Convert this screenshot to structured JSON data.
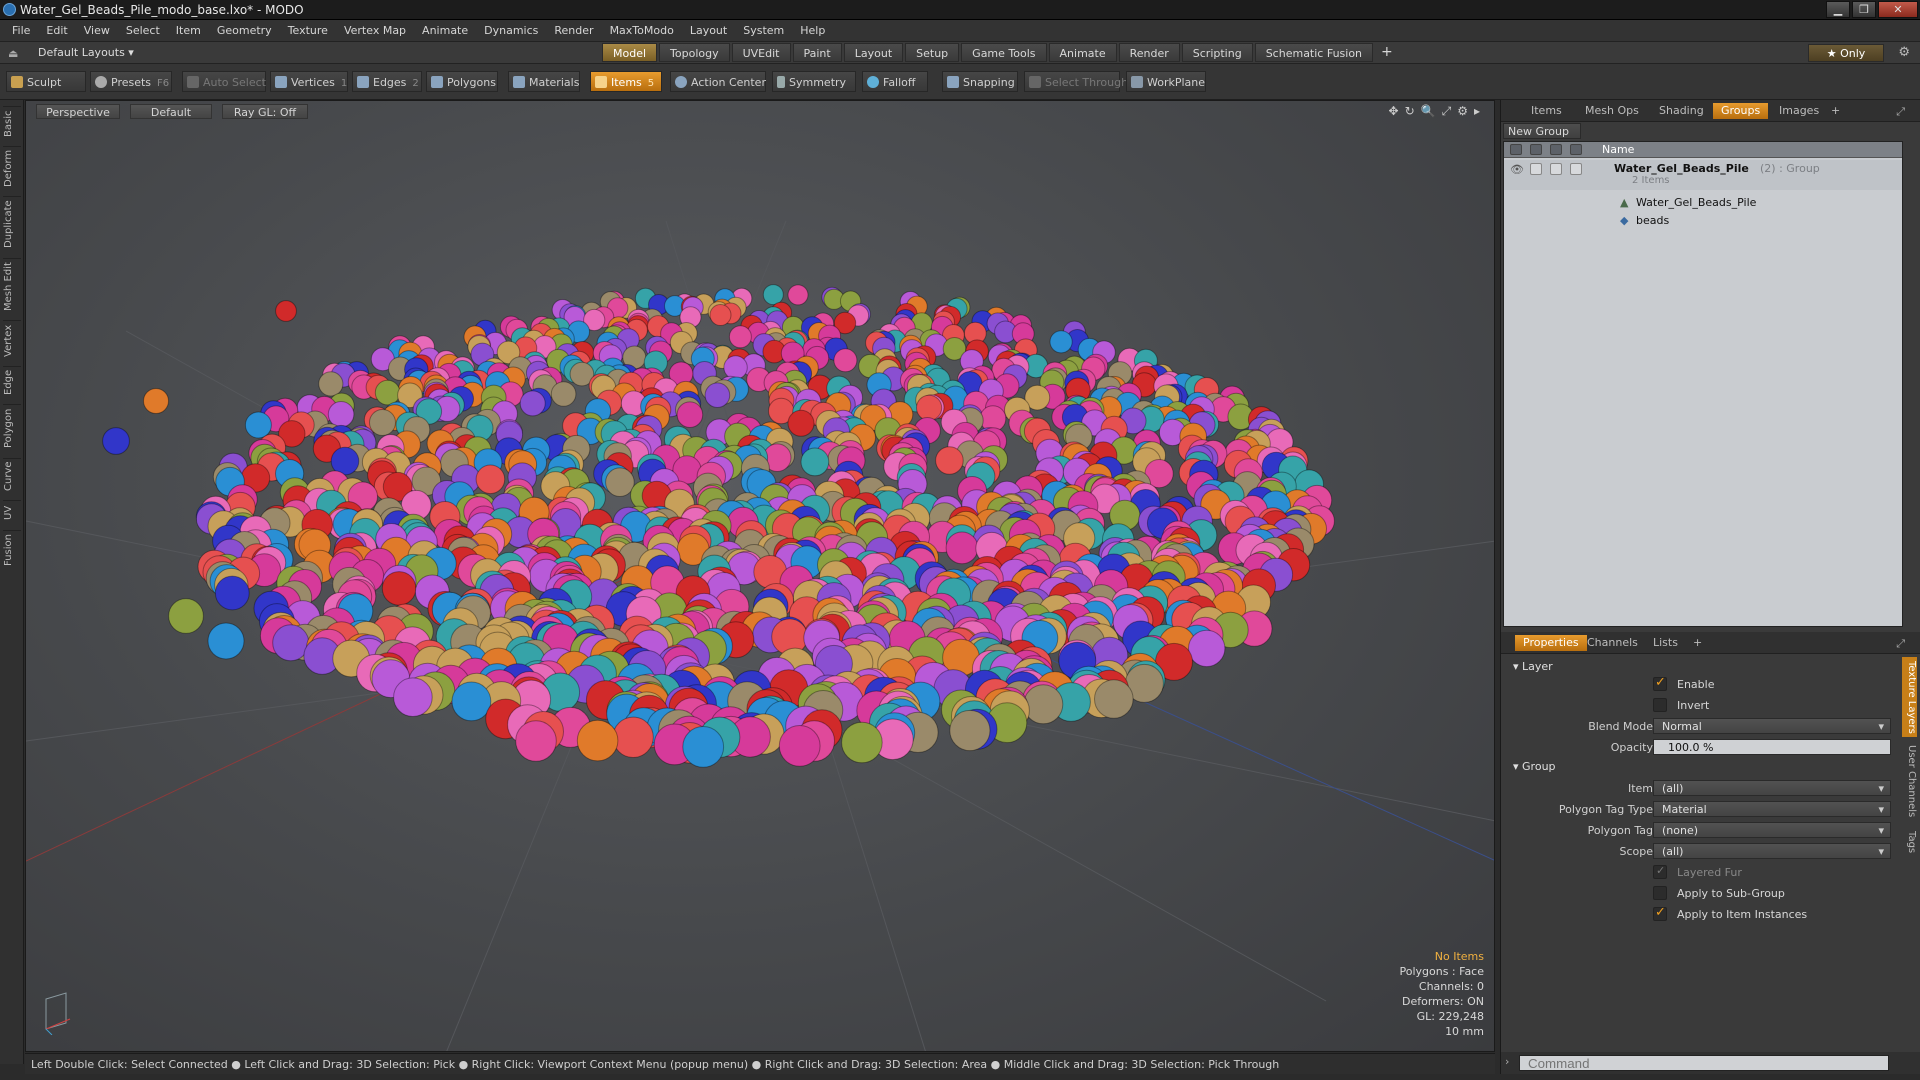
{
  "window": {
    "title": "Water_Gel_Beads_Pile_modo_base.lxo* - MODO",
    "controls": [
      "▁",
      "❐",
      "✕"
    ]
  },
  "menu": [
    "File",
    "Edit",
    "View",
    "Select",
    "Item",
    "Geometry",
    "Texture",
    "Vertex Map",
    "Animate",
    "Dynamics",
    "Render",
    "MaxToModo",
    "Layout",
    "System",
    "Help"
  ],
  "layoutbar": {
    "layouts_label": "Default Layouts ▾",
    "tabs": [
      "Model",
      "Topology",
      "UVEdit",
      "Paint",
      "Layout",
      "Setup",
      "Game Tools",
      "Animate",
      "Render",
      "Scripting",
      "Schematic Fusion"
    ],
    "active_tab": "Model",
    "plus": "+",
    "only_label": "★  Only",
    "gear": "⚙"
  },
  "toolbar": {
    "sculpt": "Sculpt",
    "presets": "Presets",
    "presets_shortcut": "F6",
    "auto_select": "Auto Select",
    "vertices": "Vertices",
    "vertices_count": "1",
    "edges": "Edges",
    "edges_count": "2",
    "polygons": "Polygons",
    "materials": "Materials",
    "items": "Items",
    "items_count": "5",
    "action_center": "Action Center",
    "symmetry": "Symmetry",
    "falloff": "Falloff",
    "snapping": "Snapping",
    "select_through": "Select Through",
    "workplane": "WorkPlane"
  },
  "left_tabs": [
    "Basic",
    "Deform",
    "Duplicate",
    "Mesh Edit",
    "Vertex",
    "Edge",
    "Polygon",
    "Curve",
    "UV",
    "Fusion"
  ],
  "viewport": {
    "view": "Perspective",
    "shading": "Default",
    "raygl": "Ray GL: Off",
    "icons": [
      "✥",
      "↻",
      "🔍",
      "⤢",
      "⚙",
      "▸"
    ],
    "hud": {
      "no_items": "No Items",
      "polygons": "Polygons : Face",
      "channels": "Channels: 0",
      "deformers": "Deformers: ON",
      "gl": "GL: 229,248",
      "scale": "10 mm"
    },
    "bead_colors": [
      "#d63a9a",
      "#e0499a",
      "#3136c9",
      "#d12a2a",
      "#e07a2a",
      "#36a3a8",
      "#8a4fd1",
      "#b85ad8",
      "#c7a05a",
      "#8ca040",
      "#e86ab8",
      "#2a8fd4",
      "#e65050",
      "#9a8a6a"
    ]
  },
  "statusbar": {
    "text": "Left Double Click: Select Connected ● Left Click and Drag: 3D Selection: Pick ● Right Click: Viewport Context Menu (popup menu) ● Right Click and Drag: 3D Selection: Area ● Middle Click and Drag: 3D Selection: Pick Through"
  },
  "groups_panel": {
    "tabs": [
      "Items",
      "Mesh Ops",
      "Shading",
      "Groups",
      "Images",
      "+"
    ],
    "active_tab": "Groups",
    "new_group": "New Group",
    "column_name": "Name",
    "rows": [
      {
        "label": "Water_Gel_Beads_Pile",
        "suffix": "(2) : Group",
        "sub": "2 Items"
      },
      {
        "label": "Water_Gel_Beads_Pile"
      },
      {
        "label": "beads"
      }
    ]
  },
  "properties": {
    "tabs": [
      "Properties",
      "Channels",
      "Lists",
      "+"
    ],
    "active_tab": "Properties",
    "layer_section": "Layer",
    "enable": "Enable",
    "invert": "Invert",
    "blend_mode_label": "Blend Mode",
    "blend_mode": "Normal",
    "opacity_label": "Opacity",
    "opacity": "100.0 %",
    "group_section": "Group",
    "item_label": "Item",
    "item": "(all)",
    "poly_tag_type_label": "Polygon Tag Type",
    "poly_tag_type": "Material",
    "poly_tag_label": "Polygon Tag",
    "poly_tag": "(none)",
    "scope_label": "Scope",
    "scope": "(all)",
    "layered_fur": "Layered Fur",
    "apply_sub_group": "Apply to Sub-Group",
    "apply_item_instances": "Apply to Item Instances",
    "side_tabs": [
      "Texture Layers",
      "User Channels",
      "Tags"
    ]
  },
  "command": {
    "placeholder": "Command"
  }
}
